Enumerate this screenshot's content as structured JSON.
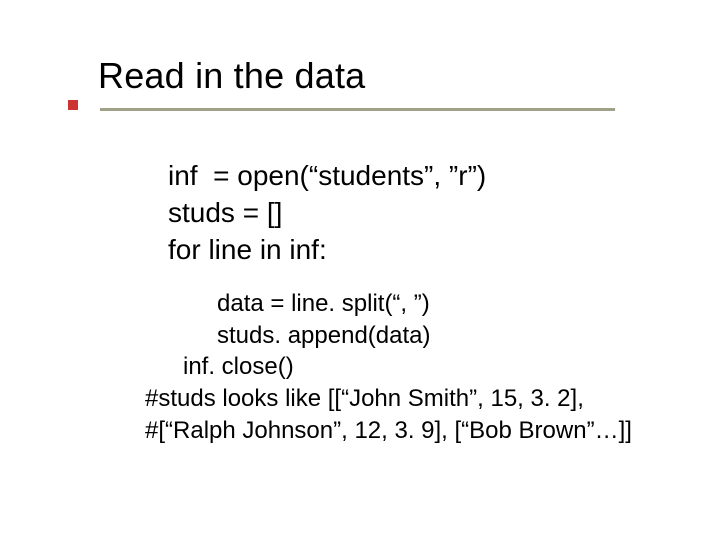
{
  "title": "Read in the data",
  "code1": {
    "l1": "inf  = open(“students”, ”r”)",
    "l2": "studs = []",
    "l3": "for line in inf:"
  },
  "code2": {
    "l1": "data = line. split(“, ”)",
    "l2": "studs. append(data)",
    "l3": "inf. close()",
    "l4": "#studs looks like [[“John Smith”, 15, 3. 2],",
    "l5": "#[“Ralph Johnson”, 12, 3. 9], [“Bob Brown”…]]"
  }
}
